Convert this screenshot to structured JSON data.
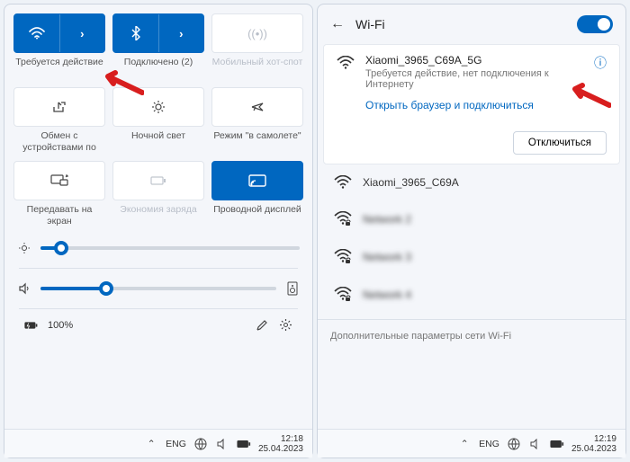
{
  "left": {
    "tiles": [
      {
        "id": "wifi",
        "label": "Требуется действие",
        "active": true,
        "split": true
      },
      {
        "id": "bluetooth",
        "label": "Подключено (2)",
        "active": true,
        "split": true
      },
      {
        "id": "hotspot",
        "label": "Мобильный хот-спот",
        "disabled": true
      },
      {
        "id": "share",
        "label": "Обмен с устройствами по"
      },
      {
        "id": "nightlight",
        "label": "Ночной свет"
      },
      {
        "id": "airplane",
        "label": "Режим \"в самолете\""
      },
      {
        "id": "project",
        "label": "Передавать на экран"
      },
      {
        "id": "battery-saver",
        "label": "Экономия заряда",
        "disabled": true
      },
      {
        "id": "cast",
        "label": "Проводной дисплей",
        "active": true
      }
    ],
    "brightness": 8,
    "volume": 28,
    "battery_text": "100%",
    "taskbar": {
      "lang": "ENG",
      "time": "12:18",
      "date": "25.04.2023"
    }
  },
  "right": {
    "title": "Wi-Fi",
    "active_net": {
      "name": "Xiaomi_3965_C69A_5G",
      "status": "Требуется действие, нет подключения к Интернету",
      "link": "Открыть браузер и подключиться",
      "button": "Отключиться"
    },
    "nets": [
      {
        "name": "Xiaomi_3965_C69A",
        "locked": false,
        "blur": false
      },
      {
        "name": "Network 2",
        "locked": true,
        "blur": true
      },
      {
        "name": "Network 3",
        "locked": true,
        "blur": true
      },
      {
        "name": "Network 4",
        "locked": true,
        "blur": true
      }
    ],
    "footer": "Дополнительные параметры сети Wi-Fi",
    "taskbar": {
      "lang": "ENG",
      "time": "12:19",
      "date": "25.04.2023"
    }
  }
}
